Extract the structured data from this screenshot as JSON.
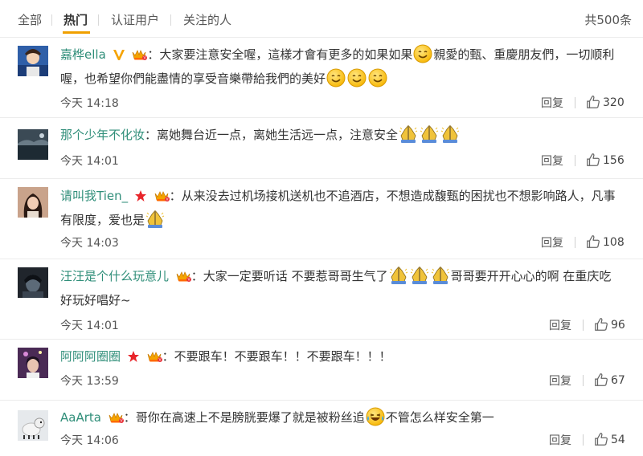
{
  "tabs": [
    "全部",
    "热门",
    "认证用户",
    "关注的人"
  ],
  "active_tab": "热门",
  "total": "共500条",
  "reply_label": "回复",
  "comments": [
    {
      "user": "嘉桦ella",
      "text_a": "：大家要注意安全喔，這樣才會有更多的如果如果",
      "text_b": "親愛的甄、重慶朋友們，一切顺利喔，也希望你們能盡情的享受音樂帶給我們的美好",
      "time": "今天 14:18",
      "likes": "320"
    },
    {
      "user": "那个少年不化妆",
      "text_a": "：离她舞台近一点，离她生活远一点，注意安全",
      "time": "今天 14:01",
      "likes": "156"
    },
    {
      "user": "请叫我Tien_",
      "text_a": "：从来没去过机场接机送机也不追酒店，不想造成馥甄的困扰也不想影响路人，凡事有限度，爱也是",
      "time": "今天 14:03",
      "likes": "108"
    },
    {
      "user": "汪汪是个什么玩意儿",
      "text_a": "：大家一定要听话 不要惹哥哥生气了",
      "text_b": "哥哥要开开心心的啊 在重庆吃好玩好唱好~",
      "time": "今天 14:01",
      "likes": "96"
    },
    {
      "user": "阿阿阿圈圈",
      "text_a": "：不要跟车！不要跟车！！不要跟车！！！",
      "time": "今天 13:59",
      "likes": "67"
    },
    {
      "user": "AaArta",
      "text_a": "：哥你在高速上不是膀胱要爆了就是被粉丝追",
      "text_b": "不管怎么样安全第一",
      "time": "今天 14:06",
      "likes": "54"
    }
  ]
}
